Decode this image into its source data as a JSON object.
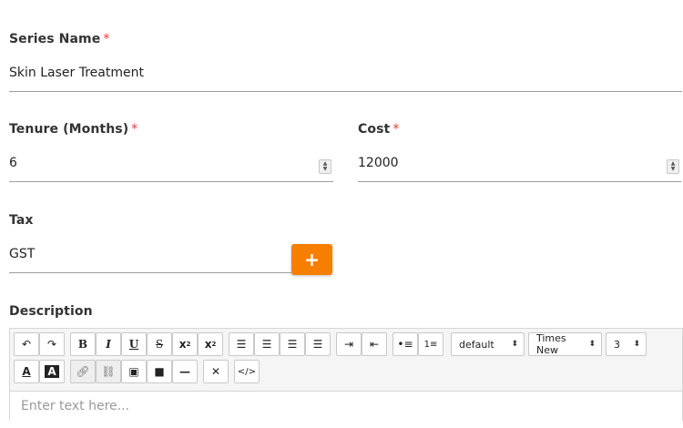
{
  "series_name": {
    "label": "Series Name",
    "required_mark": "*",
    "value": "Skin Laser Treatment"
  },
  "tenure": {
    "label": "Tenure (Months)",
    "required_mark": "*",
    "value": "6"
  },
  "cost": {
    "label": "Cost",
    "required_mark": "*",
    "value": "12000"
  },
  "tax": {
    "label": "Tax",
    "value": "GST",
    "add_label": "+"
  },
  "description": {
    "label": "Description",
    "placeholder": "Enter text here...",
    "toolbar": {
      "style_select": "default",
      "font_select": "Times New",
      "size_select": "3"
    }
  },
  "colors": {
    "accent": "#f77f00",
    "required": "#e53935"
  }
}
